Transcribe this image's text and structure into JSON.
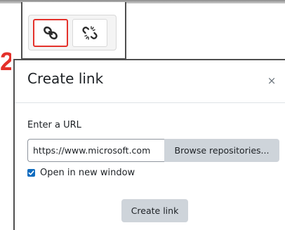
{
  "step_marker": "2",
  "toolbar": {
    "buttons": [
      {
        "name": "link",
        "icon": "link-icon",
        "highlighted": true
      },
      {
        "name": "unlink",
        "icon": "unlink-icon",
        "highlighted": false
      }
    ],
    "highlight_color": "#e4312b"
  },
  "dialog": {
    "title": "Create link",
    "close_glyph": "×",
    "url_label": "Enter a URL",
    "url_value": "https://www.microsoft.com",
    "browse_label": "Browse repositories...",
    "open_new_window_label": "Open in new window",
    "open_new_window_checked": true,
    "create_label": "Create link",
    "accent_color": "#0f6cbf"
  }
}
